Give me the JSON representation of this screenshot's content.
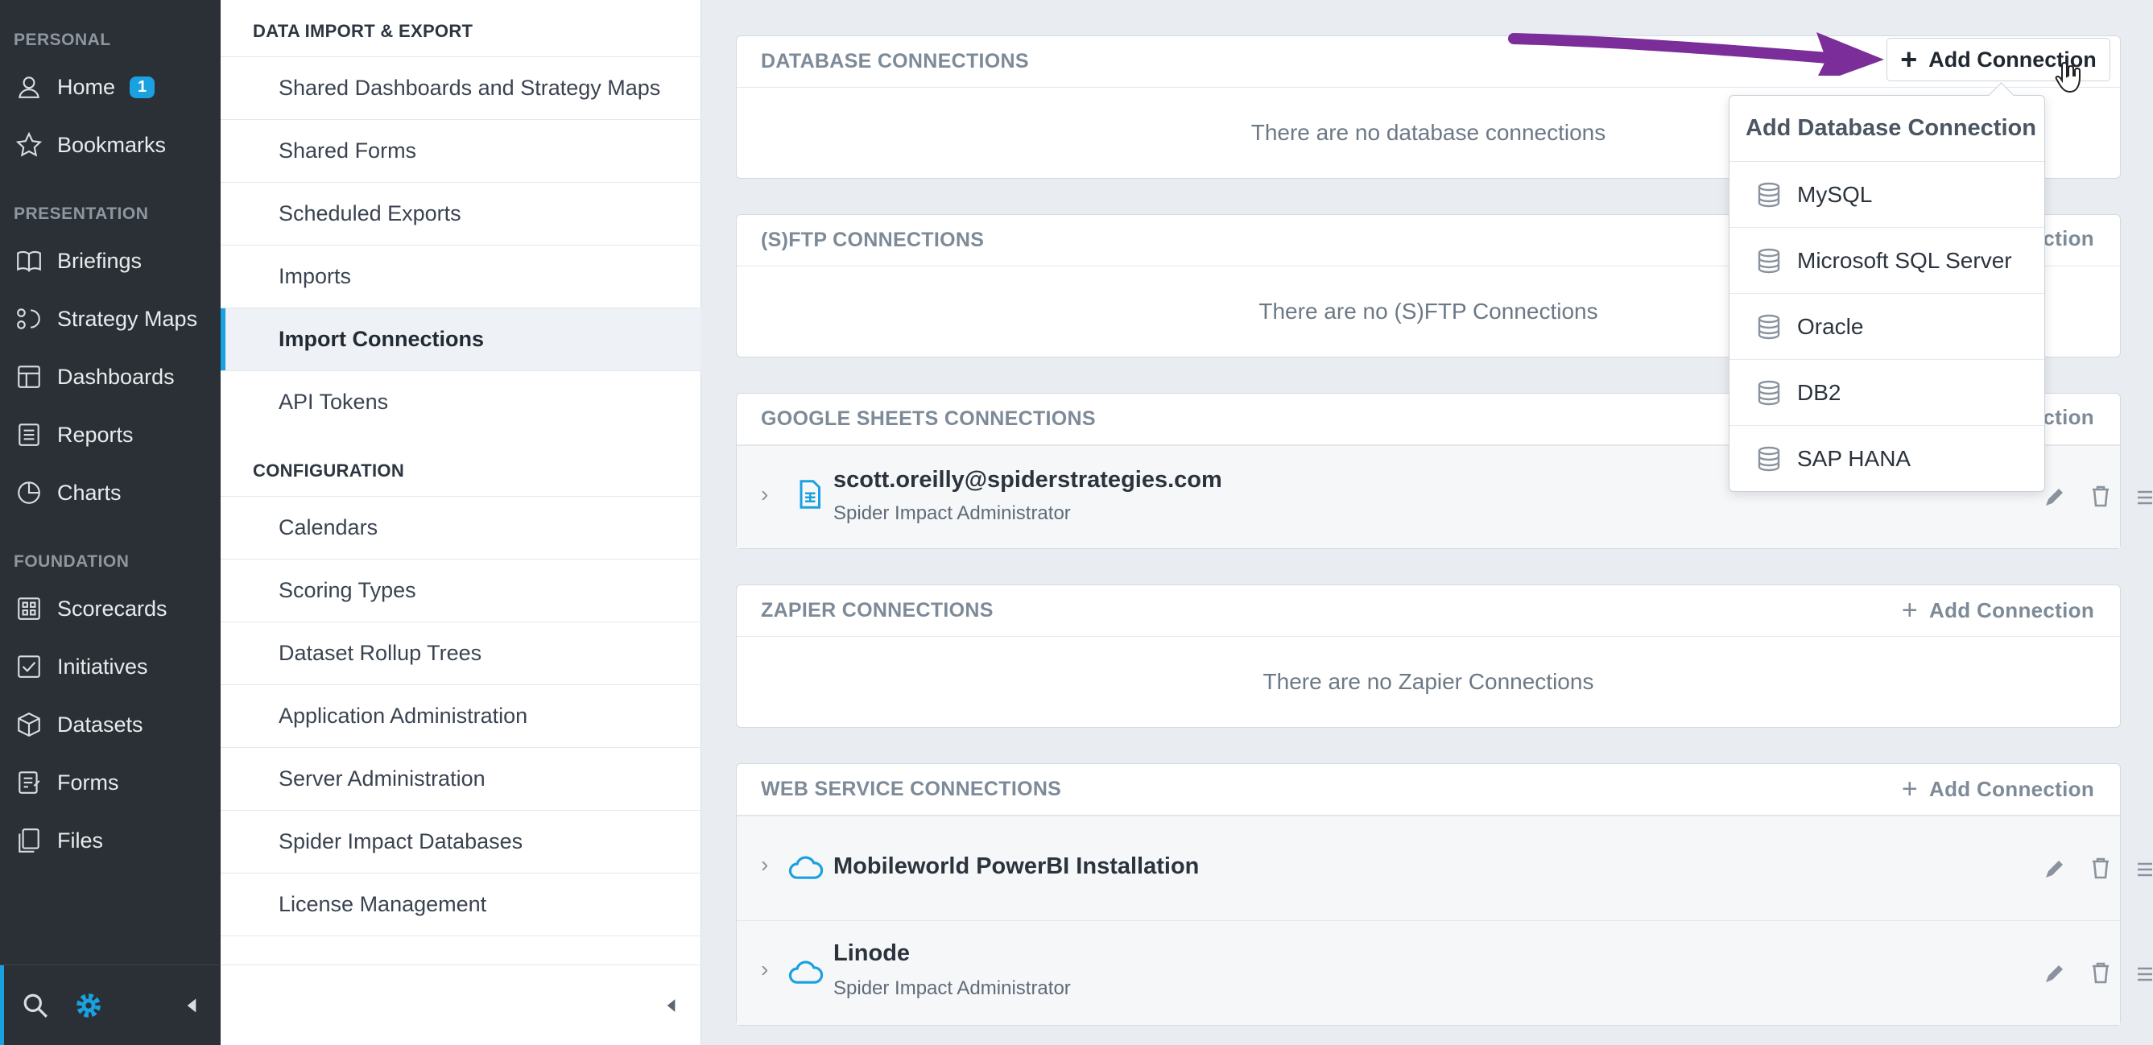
{
  "sidebar": {
    "sections": {
      "personal": "PERSONAL",
      "presentation": "PRESENTATION",
      "foundation": "FOUNDATION"
    },
    "items": [
      {
        "label": "Home",
        "icon": "user-icon",
        "badge": "1"
      },
      {
        "label": "Bookmarks",
        "icon": "star-icon"
      },
      {
        "label": "Briefings",
        "icon": "book-icon"
      },
      {
        "label": "Strategy Maps",
        "icon": "strategy-map-icon"
      },
      {
        "label": "Dashboards",
        "icon": "dashboard-icon"
      },
      {
        "label": "Reports",
        "icon": "report-icon"
      },
      {
        "label": "Charts",
        "icon": "pie-chart-icon"
      },
      {
        "label": "Scorecards",
        "icon": "scorecard-icon"
      },
      {
        "label": "Initiatives",
        "icon": "checkbox-icon"
      },
      {
        "label": "Datasets",
        "icon": "cube-icon"
      },
      {
        "label": "Forms",
        "icon": "form-icon"
      },
      {
        "label": "Files",
        "icon": "files-icon"
      }
    ],
    "accent_color": "#1aa1e0"
  },
  "nav": {
    "sections": [
      {
        "heading": "DATA IMPORT & EXPORT",
        "items": [
          "Shared Dashboards and Strategy Maps",
          "Shared Forms",
          "Scheduled Exports",
          "Imports",
          "Import Connections",
          "API Tokens"
        ]
      },
      {
        "heading": "CONFIGURATION",
        "items": [
          "Calendars",
          "Scoring Types",
          "Dataset Rollup Trees",
          "Application Administration",
          "Server Administration",
          "Spider Impact Databases",
          "License Management"
        ]
      }
    ],
    "active_item": "Import Connections"
  },
  "panels": {
    "database": {
      "title": "DATABASE CONNECTIONS",
      "empty": "There are no database connections",
      "add_label": "Add Connection"
    },
    "sftp": {
      "title": "(S)FTP CONNECTIONS",
      "empty": "There are no (S)FTP Connections",
      "add_label": "Connection"
    },
    "google": {
      "title": "GOOGLE SHEETS CONNECTIONS",
      "add_label": "Connection",
      "rows": [
        {
          "title": "scott.oreilly@spiderstrategies.com",
          "subtitle": "Spider Impact Administrator"
        }
      ]
    },
    "zapier": {
      "title": "ZAPIER CONNECTIONS",
      "empty": "There are no Zapier Connections",
      "add_label": "Add Connection"
    },
    "web": {
      "title": "WEB SERVICE CONNECTIONS",
      "add_label": "Add Connection",
      "rows": [
        {
          "title": "Mobileworld PowerBI Installation",
          "subtitle": ""
        },
        {
          "title": "Linode",
          "subtitle": "Spider Impact Administrator"
        }
      ]
    }
  },
  "dropdown": {
    "title": "Add Database Connection",
    "items": [
      "MySQL",
      "Microsoft SQL Server",
      "Oracle",
      "DB2",
      "SAP HANA"
    ]
  },
  "annotation_arrow_color": "#7b2d9a"
}
